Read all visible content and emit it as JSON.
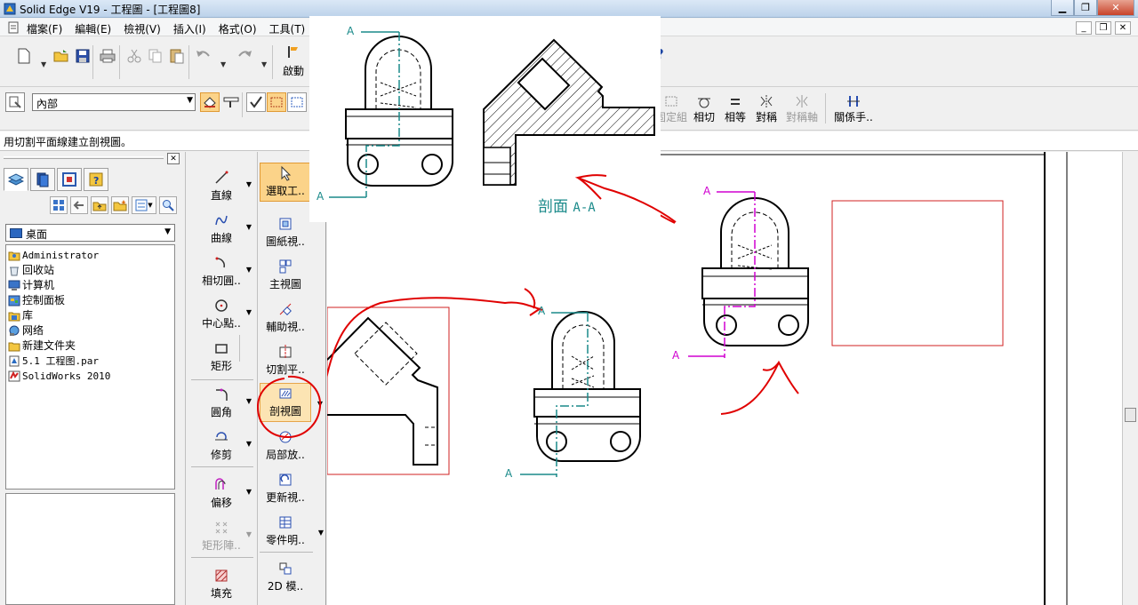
{
  "window": {
    "title": "Solid Edge V19 - 工程圖 - [工程圖8]",
    "colors": {
      "titlebar": "#bcd2ea",
      "accent_orange": "#fbd389",
      "teal": "#1a8a8a",
      "magenta": "#d000d0",
      "sketch_red": "#e00000",
      "frame_red": "#d02020"
    }
  },
  "menu": {
    "items": [
      "檔案(F)",
      "編輯(E)",
      "檢視(V)",
      "插入(I)",
      "格式(O)",
      "工具(T)"
    ]
  },
  "toolbar": {
    "start_label": "啟動",
    "help_glyph": "?"
  },
  "layer": {
    "selected": "內部"
  },
  "relations": {
    "items": [
      {
        "label": "固定組",
        "icon": "fix-group-icon",
        "enabled": false
      },
      {
        "label": "相切",
        "icon": "tangent-icon",
        "enabled": true
      },
      {
        "label": "相等",
        "icon": "equal-icon",
        "enabled": true
      },
      {
        "label": "對稱",
        "icon": "symmetric-icon",
        "enabled": true
      },
      {
        "label": "對稱軸",
        "icon": "symmetry-axis-icon",
        "enabled": false
      },
      {
        "label": "關係手..",
        "icon": "relationship-handle-icon",
        "enabled": true
      }
    ]
  },
  "prompt": {
    "text": "用切割平面線建立剖視圖。"
  },
  "library": {
    "location": "桌面",
    "tree": [
      {
        "label": "Administrator",
        "icon": "user-folder-icon"
      },
      {
        "label": "回收站",
        "icon": "recycle-bin-icon"
      },
      {
        "label": "计算机",
        "icon": "computer-icon"
      },
      {
        "label": "控制面板",
        "icon": "control-panel-icon"
      },
      {
        "label": "库",
        "icon": "library-folder-icon"
      },
      {
        "label": "网络",
        "icon": "network-icon"
      },
      {
        "label": "新建文件夹",
        "icon": "folder-icon"
      },
      {
        "label": "5.1 工程图.par",
        "icon": "part-file-icon"
      },
      {
        "label": "SolidWorks 2010",
        "icon": "solidworks-icon"
      }
    ]
  },
  "draw_tools": {
    "line": "直線",
    "curve": "曲線",
    "tangent_arc": "相切圓..",
    "center_point": "中心點..",
    "rectangle": "矩形",
    "fillet": "圓角",
    "trim": "修剪",
    "offset": "偏移",
    "rect_pattern": "矩形陣..",
    "fill": "填充"
  },
  "view_tools": {
    "select": "選取工..",
    "drawing_view": "圖紙視..",
    "principal_view": "主視圖",
    "auxiliary_view": "輔助視..",
    "cutting_plane": "切割平..",
    "section_view": "剖視圖",
    "detail_view": "局部放..",
    "update_view": "更新視..",
    "parts_list": "零件明..",
    "model_2d": "2D 模.."
  },
  "canvas": {
    "section_caption": "剖面",
    "section_name": "A-A",
    "cut_label": "A"
  }
}
